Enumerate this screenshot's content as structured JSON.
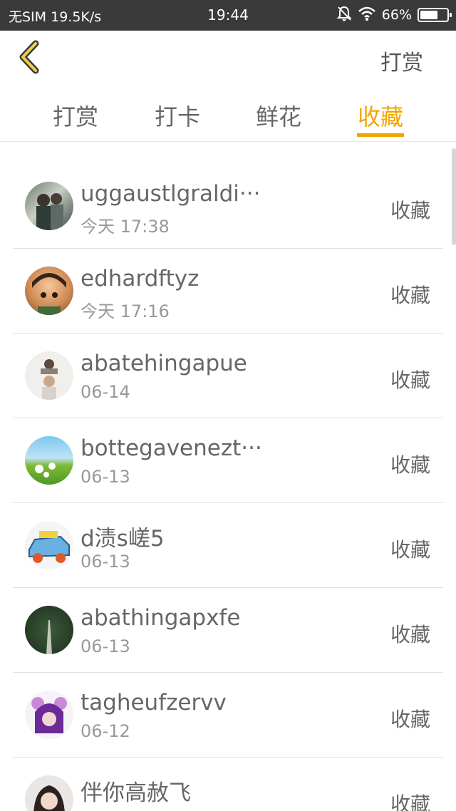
{
  "status_bar": {
    "carrier": "无SIM",
    "speed": "19.5K/s",
    "time": "19:44",
    "battery_percent": "66%",
    "battery_level": 0.66,
    "icons": [
      "mute-bell-icon",
      "wifi-icon",
      "battery-icon"
    ]
  },
  "header": {
    "back_icon": "chevron-left-icon",
    "action_label": "打赏"
  },
  "tabs": [
    {
      "label": "打赏",
      "active": false
    },
    {
      "label": "打卡",
      "active": false
    },
    {
      "label": "鲜花",
      "active": false
    },
    {
      "label": "收藏",
      "active": true
    }
  ],
  "accent_color": "#f0a500",
  "list": [
    {
      "name": "uggaustlgraldi···",
      "time": "今天 17:38",
      "type": "收藏"
    },
    {
      "name": "edhardftyz",
      "time": "今天 17:16",
      "type": "收藏"
    },
    {
      "name": "abatehingapue",
      "time": "06-14",
      "type": "收藏"
    },
    {
      "name": "bottegavenezt···",
      "time": "06-13",
      "type": "收藏"
    },
    {
      "name": "d渍s嵯5",
      "time": "06-13",
      "type": "收藏"
    },
    {
      "name": "abathingapxfe",
      "time": "06-13",
      "type": "收藏"
    },
    {
      "name": "tagheufzervv",
      "time": "06-12",
      "type": "收藏"
    },
    {
      "name": "伴你高赦飞",
      "time": "",
      "type": "收藏"
    }
  ]
}
